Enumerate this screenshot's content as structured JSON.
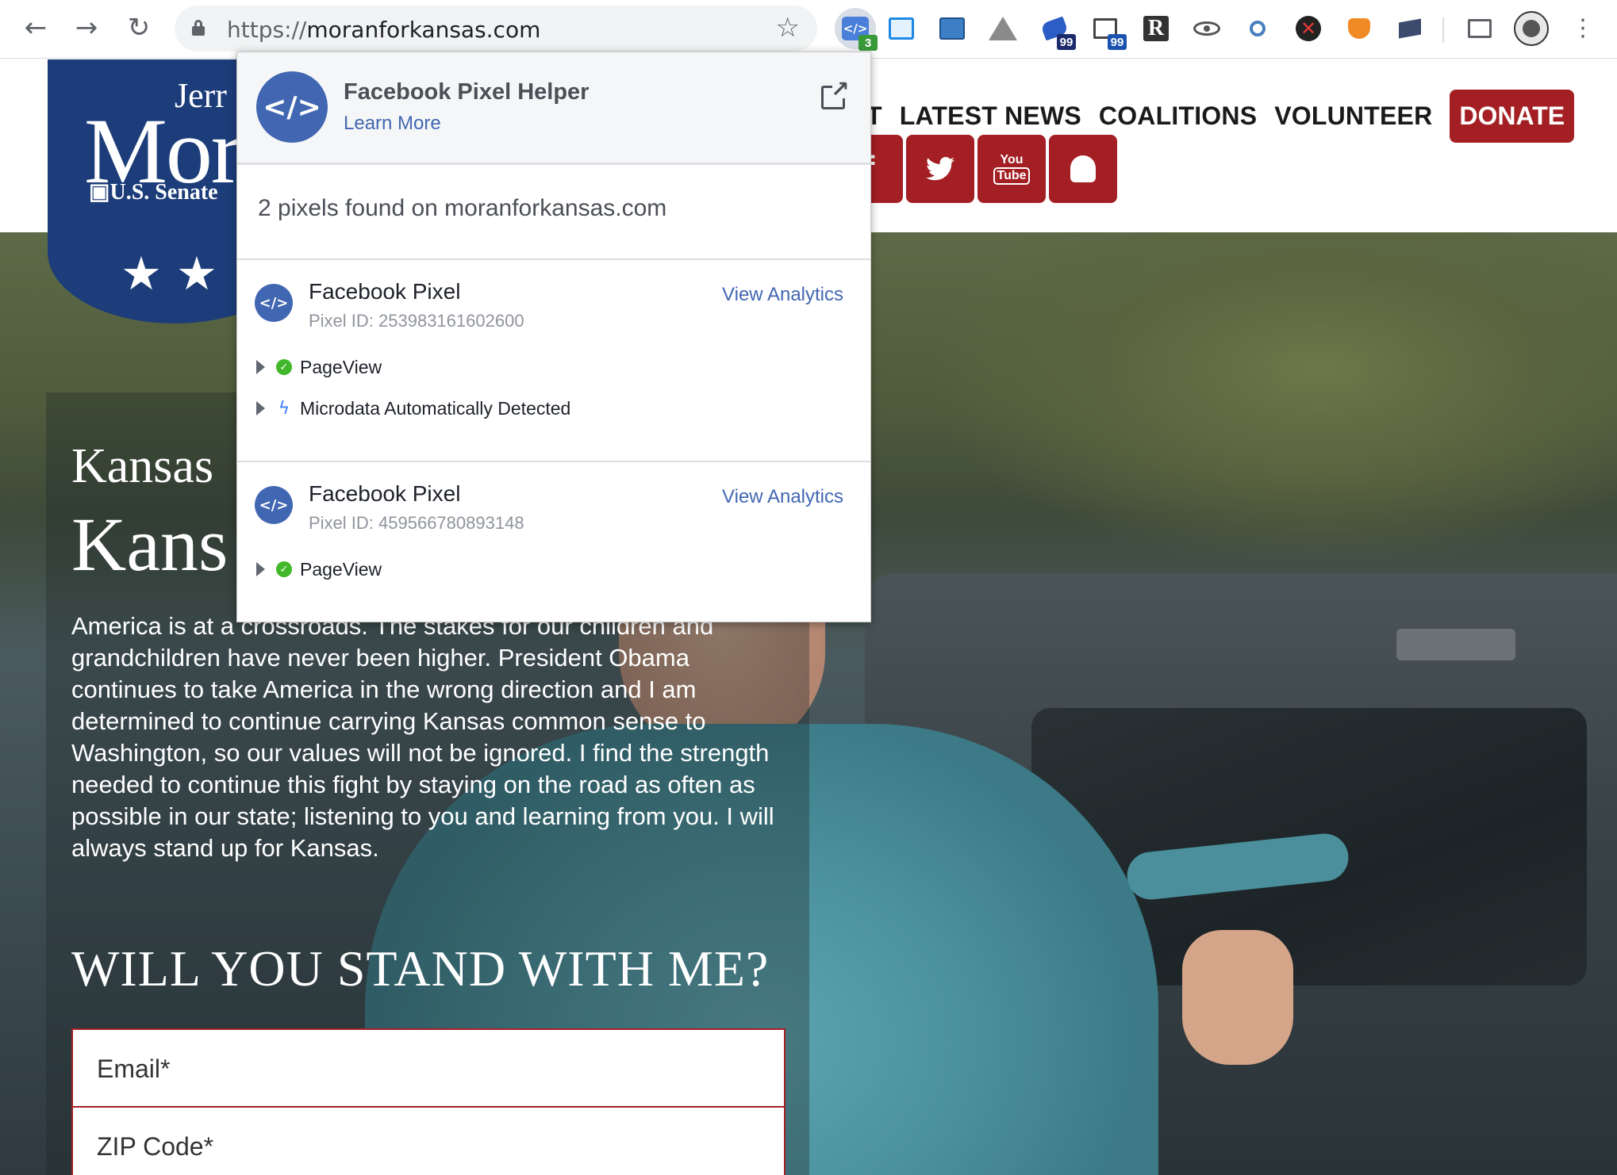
{
  "browser": {
    "url_scheme": "https://",
    "url_host": "moranforkansas.com",
    "extensions": [
      {
        "name": "facebook-pixel-helper",
        "badge": "3",
        "badge_color": "#3a9a3a"
      },
      {
        "name": "window-extension",
        "badge": ""
      },
      {
        "name": "screenshot-extension",
        "badge": ""
      },
      {
        "name": "drive-extension",
        "badge": ""
      },
      {
        "name": "pen-extension",
        "badge": "99",
        "badge_color": "#1b2b6b"
      },
      {
        "name": "tag-extension",
        "badge": "99",
        "badge_color": "#1b52b0"
      },
      {
        "name": "r-extension",
        "badge": ""
      },
      {
        "name": "eye-extension",
        "badge": ""
      },
      {
        "name": "search-extension",
        "badge": ""
      },
      {
        "name": "blocker-extension",
        "badge": ""
      },
      {
        "name": "fox-extension",
        "badge": ""
      },
      {
        "name": "flag-extension",
        "badge": ""
      }
    ]
  },
  "site": {
    "logo": {
      "first": "Jerr",
      "last": "Mor",
      "senate": "U.S. Senate"
    },
    "nav": [
      "T",
      "LATEST NEWS",
      "COALITIONS",
      "VOLUNTEER"
    ],
    "donate": "DONATE",
    "social": [
      "facebook",
      "twitter",
      "youtube",
      "snapchat"
    ],
    "youtube_top": "You",
    "youtube_bottom": "Tube",
    "heading_small": "Kansas",
    "heading_big": "Kans",
    "paragraph": "America is at a crossroads. The stakes for our children and grandchildren have never been higher. President Obama continues to take America in the wrong direction and I am determined to continue carrying Kansas common sense to Washington, so our values will not be ignored. I find the strength needed to continue this fight by staying on the road as often as possible in our state; listening to you and learning from you. I will always stand up for Kansas.",
    "cta": "WILL YOU STAND WITH ME?",
    "email_placeholder": "Email*",
    "zip_placeholder": "ZIP Code*",
    "brand_red": "#a41f23",
    "brand_blue": "#1d3d7a"
  },
  "popup": {
    "title": "Facebook Pixel Helper",
    "learn_more": "Learn More",
    "summary": "2 pixels found on moranforkansas.com",
    "pixels": [
      {
        "name": "Facebook Pixel",
        "id": "Pixel ID: 253983161602600",
        "analytics": "View Analytics",
        "events": [
          {
            "label": "PageView",
            "status": "success"
          },
          {
            "label": "Microdata Automatically Detected",
            "status": "info"
          }
        ]
      },
      {
        "name": "Facebook Pixel",
        "id": "Pixel ID: 459566780893148",
        "analytics": "View Analytics",
        "events": [
          {
            "label": "PageView",
            "status": "success"
          }
        ]
      }
    ],
    "accent": "#4267b2"
  }
}
